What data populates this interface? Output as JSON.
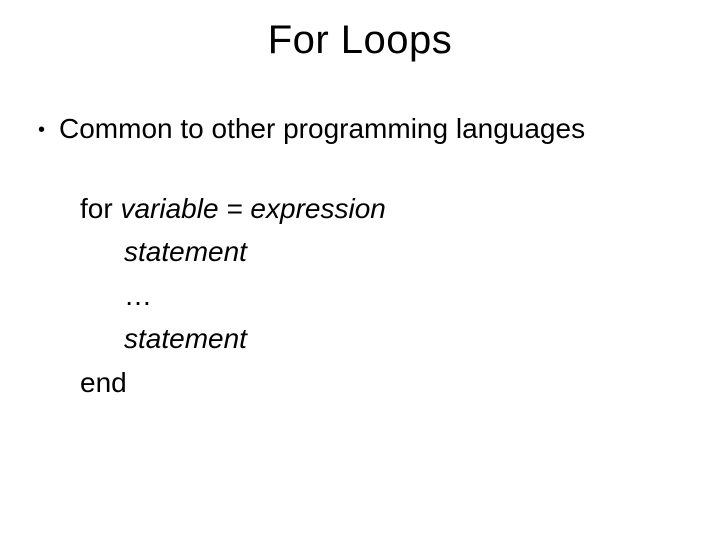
{
  "title": "For Loops",
  "bullet1": "Common to other programming languages",
  "syntax": {
    "line1_for": "for ",
    "line1_varexpr": "variable = expression",
    "line2": "statement",
    "line3": "…",
    "line4": "statement",
    "line5": "end"
  }
}
